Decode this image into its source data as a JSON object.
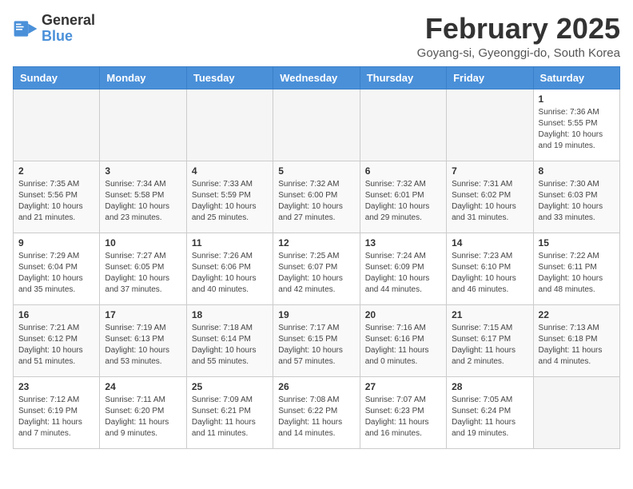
{
  "logo": {
    "line1": "General",
    "line2": "Blue"
  },
  "title": "February 2025",
  "location": "Goyang-si, Gyeonggi-do, South Korea",
  "weekdays": [
    "Sunday",
    "Monday",
    "Tuesday",
    "Wednesday",
    "Thursday",
    "Friday",
    "Saturday"
  ],
  "weeks": [
    [
      {
        "day": "",
        "info": ""
      },
      {
        "day": "",
        "info": ""
      },
      {
        "day": "",
        "info": ""
      },
      {
        "day": "",
        "info": ""
      },
      {
        "day": "",
        "info": ""
      },
      {
        "day": "",
        "info": ""
      },
      {
        "day": "1",
        "info": "Sunrise: 7:36 AM\nSunset: 5:55 PM\nDaylight: 10 hours\nand 19 minutes."
      }
    ],
    [
      {
        "day": "2",
        "info": "Sunrise: 7:35 AM\nSunset: 5:56 PM\nDaylight: 10 hours\nand 21 minutes."
      },
      {
        "day": "3",
        "info": "Sunrise: 7:34 AM\nSunset: 5:58 PM\nDaylight: 10 hours\nand 23 minutes."
      },
      {
        "day": "4",
        "info": "Sunrise: 7:33 AM\nSunset: 5:59 PM\nDaylight: 10 hours\nand 25 minutes."
      },
      {
        "day": "5",
        "info": "Sunrise: 7:32 AM\nSunset: 6:00 PM\nDaylight: 10 hours\nand 27 minutes."
      },
      {
        "day": "6",
        "info": "Sunrise: 7:32 AM\nSunset: 6:01 PM\nDaylight: 10 hours\nand 29 minutes."
      },
      {
        "day": "7",
        "info": "Sunrise: 7:31 AM\nSunset: 6:02 PM\nDaylight: 10 hours\nand 31 minutes."
      },
      {
        "day": "8",
        "info": "Sunrise: 7:30 AM\nSunset: 6:03 PM\nDaylight: 10 hours\nand 33 minutes."
      }
    ],
    [
      {
        "day": "9",
        "info": "Sunrise: 7:29 AM\nSunset: 6:04 PM\nDaylight: 10 hours\nand 35 minutes."
      },
      {
        "day": "10",
        "info": "Sunrise: 7:27 AM\nSunset: 6:05 PM\nDaylight: 10 hours\nand 37 minutes."
      },
      {
        "day": "11",
        "info": "Sunrise: 7:26 AM\nSunset: 6:06 PM\nDaylight: 10 hours\nand 40 minutes."
      },
      {
        "day": "12",
        "info": "Sunrise: 7:25 AM\nSunset: 6:07 PM\nDaylight: 10 hours\nand 42 minutes."
      },
      {
        "day": "13",
        "info": "Sunrise: 7:24 AM\nSunset: 6:09 PM\nDaylight: 10 hours\nand 44 minutes."
      },
      {
        "day": "14",
        "info": "Sunrise: 7:23 AM\nSunset: 6:10 PM\nDaylight: 10 hours\nand 46 minutes."
      },
      {
        "day": "15",
        "info": "Sunrise: 7:22 AM\nSunset: 6:11 PM\nDaylight: 10 hours\nand 48 minutes."
      }
    ],
    [
      {
        "day": "16",
        "info": "Sunrise: 7:21 AM\nSunset: 6:12 PM\nDaylight: 10 hours\nand 51 minutes."
      },
      {
        "day": "17",
        "info": "Sunrise: 7:19 AM\nSunset: 6:13 PM\nDaylight: 10 hours\nand 53 minutes."
      },
      {
        "day": "18",
        "info": "Sunrise: 7:18 AM\nSunset: 6:14 PM\nDaylight: 10 hours\nand 55 minutes."
      },
      {
        "day": "19",
        "info": "Sunrise: 7:17 AM\nSunset: 6:15 PM\nDaylight: 10 hours\nand 57 minutes."
      },
      {
        "day": "20",
        "info": "Sunrise: 7:16 AM\nSunset: 6:16 PM\nDaylight: 11 hours\nand 0 minutes."
      },
      {
        "day": "21",
        "info": "Sunrise: 7:15 AM\nSunset: 6:17 PM\nDaylight: 11 hours\nand 2 minutes."
      },
      {
        "day": "22",
        "info": "Sunrise: 7:13 AM\nSunset: 6:18 PM\nDaylight: 11 hours\nand 4 minutes."
      }
    ],
    [
      {
        "day": "23",
        "info": "Sunrise: 7:12 AM\nSunset: 6:19 PM\nDaylight: 11 hours\nand 7 minutes."
      },
      {
        "day": "24",
        "info": "Sunrise: 7:11 AM\nSunset: 6:20 PM\nDaylight: 11 hours\nand 9 minutes."
      },
      {
        "day": "25",
        "info": "Sunrise: 7:09 AM\nSunset: 6:21 PM\nDaylight: 11 hours\nand 11 minutes."
      },
      {
        "day": "26",
        "info": "Sunrise: 7:08 AM\nSunset: 6:22 PM\nDaylight: 11 hours\nand 14 minutes."
      },
      {
        "day": "27",
        "info": "Sunrise: 7:07 AM\nSunset: 6:23 PM\nDaylight: 11 hours\nand 16 minutes."
      },
      {
        "day": "28",
        "info": "Sunrise: 7:05 AM\nSunset: 6:24 PM\nDaylight: 11 hours\nand 19 minutes."
      },
      {
        "day": "",
        "info": ""
      }
    ]
  ]
}
